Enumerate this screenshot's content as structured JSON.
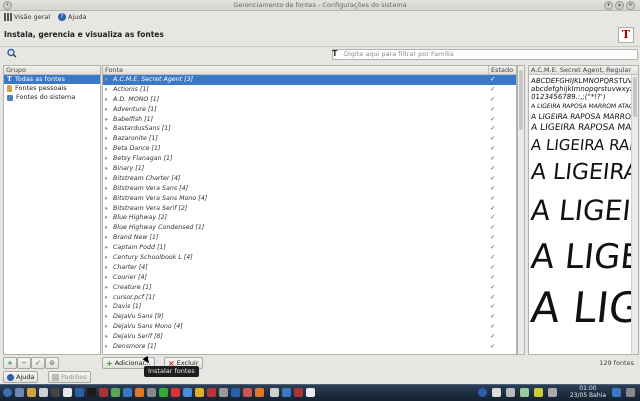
{
  "window": {
    "title": "Gerenciamento de fontes - Configurações do sistema"
  },
  "toolbar": {
    "overview_label": "Visão geral",
    "help_label": "Ajuda"
  },
  "header": {
    "title": "Instala, gerencia e visualiza as fontes"
  },
  "filter": {
    "placeholder": "Digite aqui para filtrar por Família"
  },
  "groups": {
    "header": "Grupo",
    "items": [
      {
        "label": "Todas as fontes",
        "selected": true
      },
      {
        "label": "Fontes pessoais",
        "selected": false
      },
      {
        "label": "Fontes do sistema",
        "selected": false
      }
    ]
  },
  "fonts": {
    "col_font": "Fonte",
    "col_state": "Estado",
    "items": [
      "A.C.M.E. Secret Agent [3]",
      "Actionis [1]",
      "A.D. MONO [1]",
      "Adventure [1]",
      "Babelfish [1]",
      "BastardusSans [1]",
      "Bazaronite [1]",
      "Beta Dance [1]",
      "Betsy Flanagan [1]",
      "Binary [1]",
      "Bitstream Charter [4]",
      "Bitstream Vera Sans [4]",
      "Bitstream Vera Sans Mono [4]",
      "Bitstream Vera Serif [2]",
      "Blue Highway [2]",
      "Blue Highway Condensed [1]",
      "Brand New [1]",
      "Captain Podd [1]",
      "Century Schoolbook L [4]",
      "Charter [4]",
      "Courier [4]",
      "Creature [1]",
      "cursor.pcf [1]",
      "Davis [1]",
      "DejaVu Sans [9]",
      "DejaVu Sans Mono [4]",
      "DejaVu Serif [8]",
      "Densmore [1]"
    ]
  },
  "preview": {
    "title": "A.C.M.E. Secret Agent, Regular",
    "charset": [
      "ABCDEFGHIJKLMNOPQRSTUVWXYZ",
      "abcdefghijklmnopqrstuvwxyz",
      "0123456789.:,;(\"*!?')"
    ],
    "samples": [
      "A LIGEIRA RAPOSA MARROM ATACA O CÃO PREGUIÇOSO",
      "A LIGEIRA RAPOSA MARROM ATACA O CÃO",
      "A LIGEIRA RAPOSA MARROM ATACA",
      "A LIGEIRA RAPOSA",
      "A LIGEIRA",
      "A LIGEIRA",
      "A LIGEIRA",
      "A LIGEIRA"
    ]
  },
  "actions": {
    "add_label": "Adicionar...",
    "delete_label": "Excluir",
    "count": "129 fontes"
  },
  "tooltip": "Instalar fontes",
  "footer": {
    "help_label": "Ajuda",
    "defaults_label": "Padrões"
  },
  "taskbar": {
    "time": "01:00",
    "date": "23/05 Bahia"
  },
  "colors": {
    "selection": "#3b78c8",
    "accent_red": "#cc2222",
    "checkmark": "#2a5db0"
  }
}
